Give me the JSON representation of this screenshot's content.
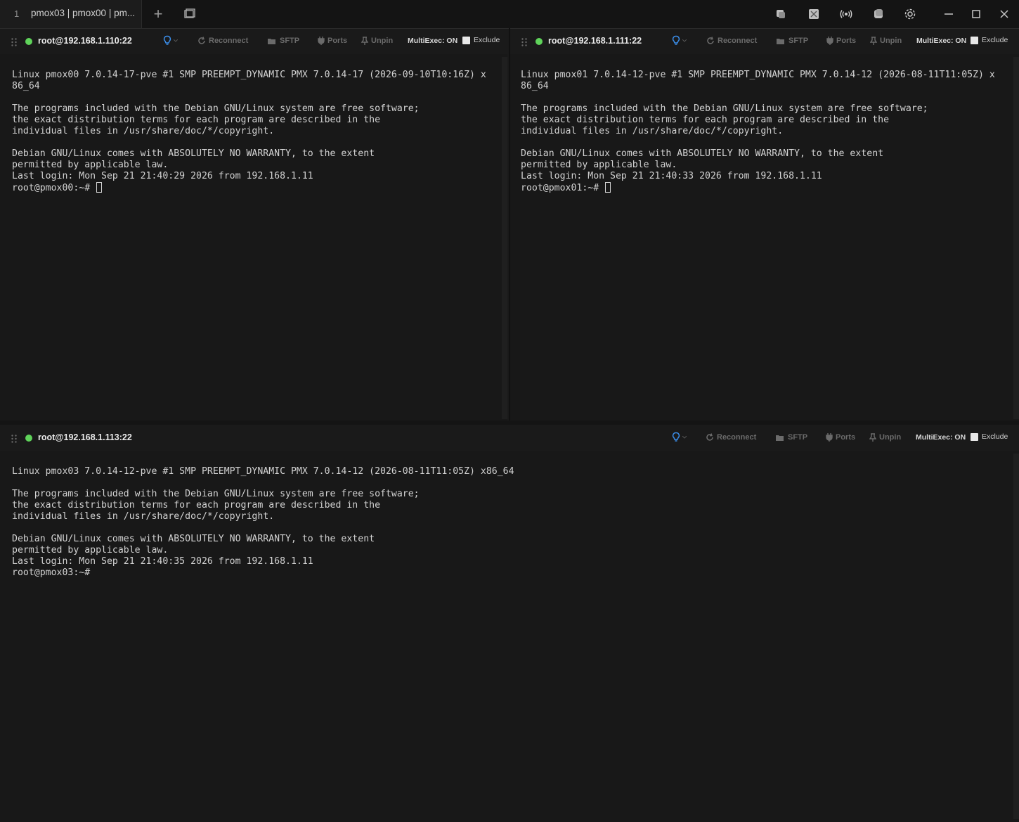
{
  "titlebar": {
    "tab": {
      "index": "1",
      "title": "pmox03 | pmox00 | pm..."
    },
    "add_tab": "+",
    "icons": [
      "tab-overview-icon",
      "split-icon",
      "broadcast-icon",
      "stack-icon",
      "settings-icon"
    ],
    "window": {
      "minimize": "–",
      "maximize": "☐",
      "close": "✕"
    }
  },
  "colors": {
    "status_connected": "#5fd35a",
    "accent_bulb": "#3b8eea",
    "background": "#181818"
  },
  "panes": [
    {
      "host": "root@192.168.1.110:22",
      "actions": {
        "reconnect": "Reconnect",
        "sftp": "SFTP",
        "ports": "Ports",
        "unpin": "Unpin"
      },
      "multiexec": "MultiExec: ON",
      "exclude": "Exclude",
      "lines": [
        "Linux pmox00 7.0.14-17-pve #1 SMP PREEMPT_DYNAMIC PMX 7.0.14-17 (2026-09-10T10:16Z) x",
        "86_64",
        "",
        "The programs included with the Debian GNU/Linux system are free software;",
        "the exact distribution terms for each program are described in the",
        "individual files in /usr/share/doc/*/copyright.",
        "",
        "Debian GNU/Linux comes with ABSOLUTELY NO WARRANTY, to the extent",
        "permitted by applicable law.",
        "Last login: Mon Sep 21 21:40:29 2026 from 192.168.1.11"
      ],
      "prompt": "root@pmox00:~# "
    },
    {
      "host": "root@192.168.1.111:22",
      "actions": {
        "reconnect": "Reconnect",
        "sftp": "SFTP",
        "ports": "Ports",
        "unpin": "Unpin"
      },
      "multiexec": "MultiExec: ON",
      "exclude": "Exclude",
      "lines": [
        "Linux pmox01 7.0.14-12-pve #1 SMP PREEMPT_DYNAMIC PMX 7.0.14-12 (2026-08-11T11:05Z) x",
        "86_64",
        "",
        "The programs included with the Debian GNU/Linux system are free software;",
        "the exact distribution terms for each program are described in the",
        "individual files in /usr/share/doc/*/copyright.",
        "",
        "Debian GNU/Linux comes with ABSOLUTELY NO WARRANTY, to the extent",
        "permitted by applicable law.",
        "Last login: Mon Sep 21 21:40:33 2026 from 192.168.1.11"
      ],
      "prompt": "root@pmox01:~# "
    },
    {
      "host": "root@192.168.1.113:22",
      "actions": {
        "reconnect": "Reconnect",
        "sftp": "SFTP",
        "ports": "Ports",
        "unpin": "Unpin"
      },
      "multiexec": "MultiExec: ON",
      "exclude": "Exclude",
      "lines": [
        "Linux pmox03 7.0.14-12-pve #1 SMP PREEMPT_DYNAMIC PMX 7.0.14-12 (2026-08-11T11:05Z) x86_64",
        "",
        "The programs included with the Debian GNU/Linux system are free software;",
        "the exact distribution terms for each program are described in the",
        "individual files in /usr/share/doc/*/copyright.",
        "",
        "Debian GNU/Linux comes with ABSOLUTELY NO WARRANTY, to the extent",
        "permitted by applicable law.",
        "Last login: Mon Sep 21 21:40:35 2026 from 192.168.1.11"
      ],
      "prompt": "root@pmox03:~#"
    }
  ]
}
